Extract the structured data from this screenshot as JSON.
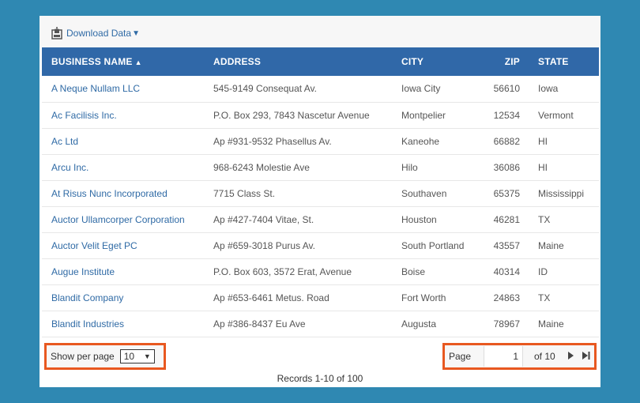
{
  "toolbar": {
    "download_label": "Download Data",
    "download_caret": "▼"
  },
  "table": {
    "columns": {
      "name": "BUSINESS NAME",
      "name_sort": "▲",
      "address": "ADDRESS",
      "city": "CITY",
      "zip": "ZIP",
      "state": "STATE"
    },
    "rows": [
      {
        "name": "A Neque Nullam LLC",
        "address": "545-9149 Consequat Av.",
        "city": "Iowa City",
        "zip": "56610",
        "state": "Iowa"
      },
      {
        "name": "Ac Facilisis Inc.",
        "address": "P.O. Box 293, 7843 Nascetur Avenue",
        "city": "Montpelier",
        "zip": "12534",
        "state": "Vermont"
      },
      {
        "name": "Ac Ltd",
        "address": "Ap #931-9532 Phasellus Av.",
        "city": "Kaneohe",
        "zip": "66882",
        "state": "HI"
      },
      {
        "name": "Arcu Inc.",
        "address": "968-6243 Molestie Ave",
        "city": "Hilo",
        "zip": "36086",
        "state": "HI"
      },
      {
        "name": "At Risus Nunc Incorporated",
        "address": "7715 Class St.",
        "city": "Southaven",
        "zip": "65375",
        "state": "Mississippi"
      },
      {
        "name": "Auctor Ullamcorper Corporation",
        "address": "Ap #427-7404 Vitae, St.",
        "city": "Houston",
        "zip": "46281",
        "state": "TX"
      },
      {
        "name": "Auctor Velit Eget PC",
        "address": "Ap #659-3018 Purus Av.",
        "city": "South Portland",
        "zip": "43557",
        "state": "Maine"
      },
      {
        "name": "Augue Institute",
        "address": "P.O. Box 603, 3572 Erat, Avenue",
        "city": "Boise",
        "zip": "40314",
        "state": "ID"
      },
      {
        "name": "Blandit Company",
        "address": "Ap #653-6461 Metus. Road",
        "city": "Fort Worth",
        "zip": "24863",
        "state": "TX"
      },
      {
        "name": "Blandit Industries",
        "address": "Ap #386-8437 Eu Ave",
        "city": "Augusta",
        "zip": "78967",
        "state": "Maine"
      }
    ]
  },
  "per_page": {
    "label": "Show per page",
    "value": "10"
  },
  "pager": {
    "page_label": "Page",
    "page_value": "1",
    "of_label": "of 10"
  },
  "footer": {
    "records": "Records 1-10 of 100"
  },
  "icons": {
    "download": "save-download-icon",
    "next": "next-page-icon",
    "last": "last-page-icon"
  },
  "colors": {
    "background": "#2f88b2",
    "header": "#3068a8",
    "link": "#2f6aa5",
    "highlight": "#e85820"
  }
}
